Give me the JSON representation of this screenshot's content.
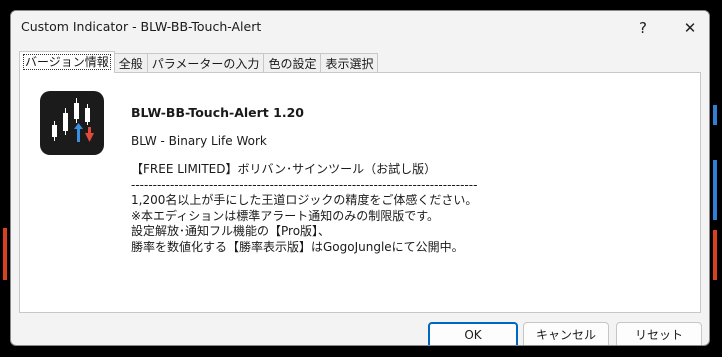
{
  "window": {
    "title": "Custom Indicator - BLW-BB-Touch-Alert",
    "help_glyph": "?",
    "close_glyph": "✕"
  },
  "tabs": [
    {
      "label": "バージョン情報",
      "active": true
    },
    {
      "label": "全般",
      "active": false
    },
    {
      "label": "パラメーターの入力",
      "active": false
    },
    {
      "label": "色の設定",
      "active": false
    },
    {
      "label": "表示選択",
      "active": false
    }
  ],
  "about": {
    "logo_icon": "candlestick-chart-icon",
    "name": "BLW-BB-Touch-Alert 1.20",
    "company": "BLW - Binary Life Work",
    "description": "【FREE LIMITED】ボリバン･サインツール（お試し版）\n--------------------------------------------------------------------------------\n1,200名以上が手にした王道ロジックの精度をご体感ください。\n※本エディションは標準アラート通知のみの制限版です。\n設定解放･通知フル機能の【Pro版】、\n勝率を数値化する【勝率表示版】はGogoJungleにて公開中。"
  },
  "buttons": {
    "ok": "OK",
    "cancel": "キャンセル",
    "reset": "リセット"
  },
  "colors": {
    "accent": "#0067c0",
    "up_arrow": "#3a8fe0",
    "down_arrow": "#e04a3a"
  }
}
